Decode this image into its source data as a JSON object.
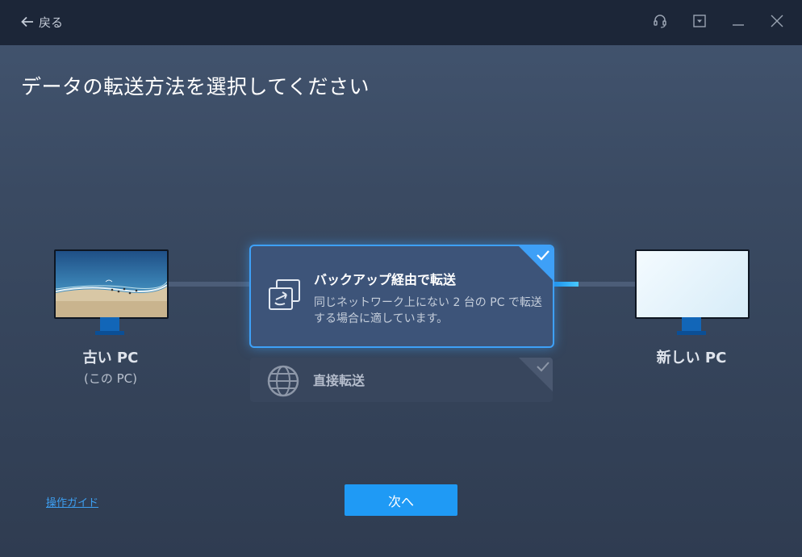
{
  "titlebar": {
    "back_label": "戻る",
    "icons": [
      "headset-icon",
      "dropdown-icon",
      "minimize-icon",
      "close-icon"
    ]
  },
  "page_title": "データの転送方法を選択してください",
  "old_pc": {
    "label": "古い PC",
    "sublabel": "(この PC)"
  },
  "new_pc": {
    "label": "新しい PC"
  },
  "options": {
    "backup": {
      "title": "バックアップ経由で転送",
      "description": "同じネットワーク上にない 2 台の PC で転送する場合に適しています。",
      "selected": true,
      "icon": "backup-transfer-icon"
    },
    "direct": {
      "title": "直接転送",
      "selected": false,
      "icon": "globe-icon"
    }
  },
  "footer": {
    "guide_label": "操作ガイド",
    "next_label": "次へ"
  },
  "colors": {
    "accent": "#1f9af5",
    "titlebar": "#1c2638",
    "card_selected": "#3d5479"
  }
}
